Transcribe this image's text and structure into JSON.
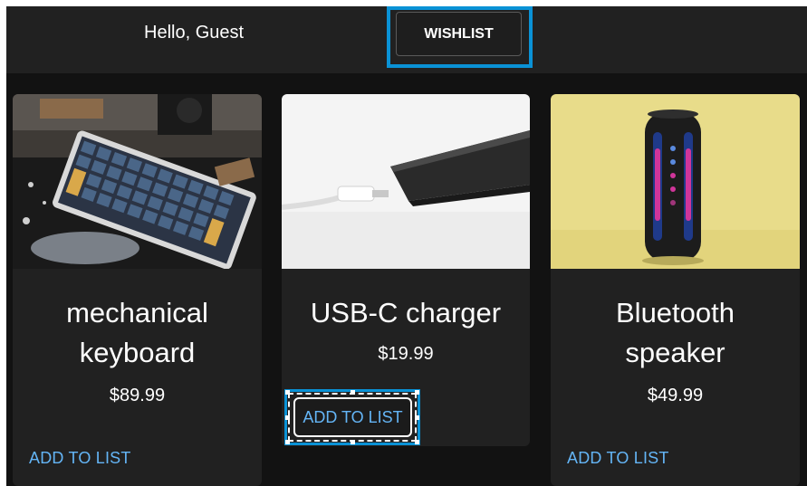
{
  "header": {
    "greeting": "Hello, Guest",
    "wishlist_label": "WISHLIST"
  },
  "products": [
    {
      "title_line1": "mechanical",
      "title_line2": "keyboard",
      "price": "$89.99",
      "action": "ADD TO LIST",
      "image": "keyboard-photo"
    },
    {
      "title_line1": "USB-C charger",
      "price": "$19.99",
      "action": "ADD TO LIST",
      "image": "charger-photo"
    },
    {
      "title_line1": "Bluetooth",
      "title_line2": "speaker",
      "price": "$49.99",
      "action": "ADD TO LIST",
      "image": "speaker-photo"
    }
  ],
  "colors": {
    "background": "#121212",
    "header": "#212121",
    "card": "#212121",
    "accent_link": "#64b5f6",
    "focus_ring": "#0a92d6"
  }
}
